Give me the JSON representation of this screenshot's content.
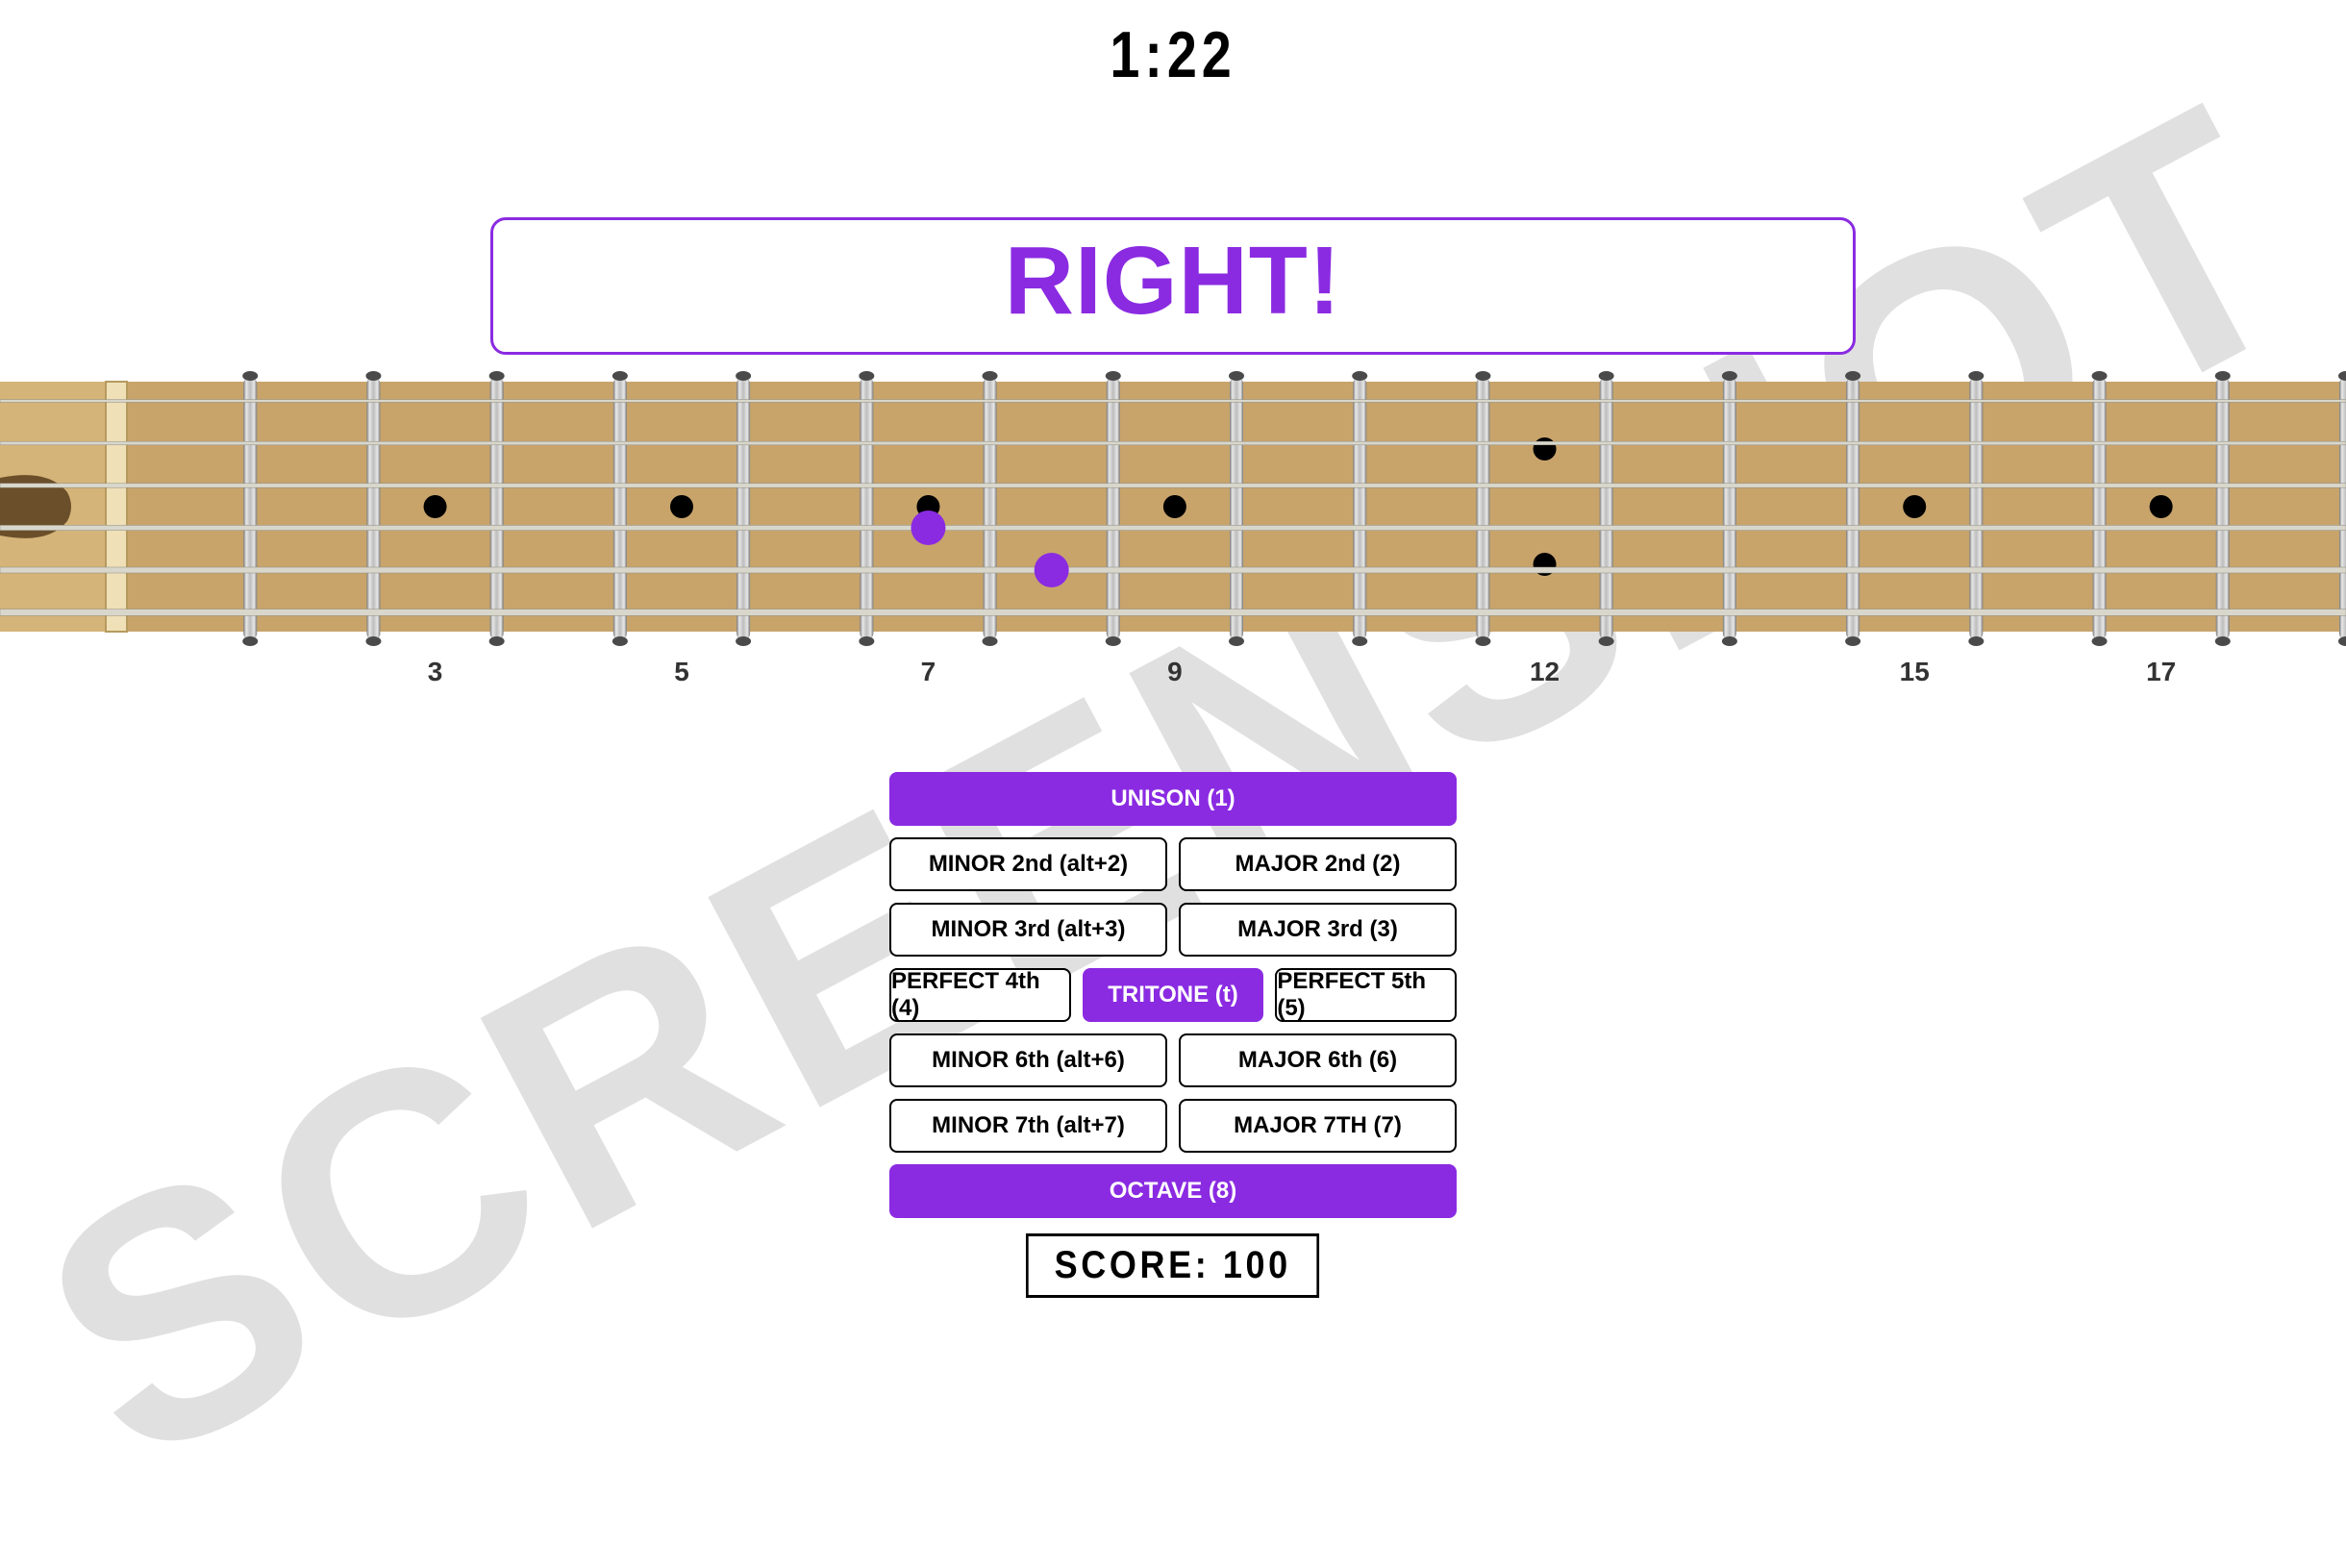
{
  "watermark": "SCREENSHOT",
  "timer": "1:22",
  "feedback": "RIGHT!",
  "score_label": "SCORE: 100",
  "fret_number_labels": [
    "3",
    "5",
    "7",
    "9",
    "12",
    "15",
    "17"
  ],
  "fretboard": {
    "strings": 6,
    "frets_visible": 18,
    "inlay_frets_single": [
      3,
      5,
      7,
      9,
      15,
      17
    ],
    "inlay_frets_double": [
      12
    ],
    "markers": [
      {
        "string": 4,
        "fret": 7,
        "color": "#8a2be2"
      },
      {
        "string": 5,
        "fret": 8,
        "color": "#8a2be2"
      }
    ]
  },
  "answers": {
    "unison": "UNISON (1)",
    "min2": "MINOR 2nd (alt+2)",
    "maj2": "MAJOR 2nd (2)",
    "min3": "MINOR 3rd (alt+3)",
    "maj3": "MAJOR 3rd (3)",
    "p4": "PERFECT 4th (4)",
    "tritone": "TRITONE (t)",
    "p5": "PERFECT 5th (5)",
    "min6": "MINOR 6th (alt+6)",
    "maj6": "MAJOR 6th (6)",
    "min7": "MINOR 7th (alt+7)",
    "maj7": "MAJOR 7TH (7)",
    "octave": "OCTAVE (8)"
  },
  "selected_answer": "tritone"
}
